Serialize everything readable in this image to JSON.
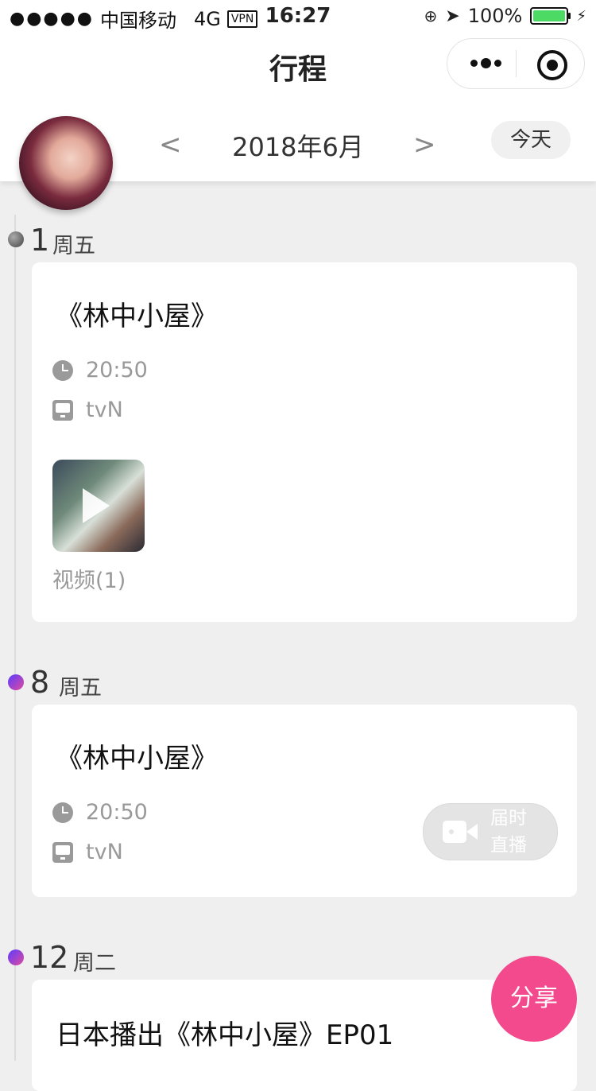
{
  "status_bar": {
    "signal_dots": "●●●●●",
    "carrier": "中国移动",
    "network": "4G",
    "vpn": "VPN",
    "time": "16:27",
    "battery": "100%"
  },
  "nav": {
    "title": "行程"
  },
  "month_bar": {
    "prev": "<",
    "month": "2018年6月",
    "next": ">",
    "today": "今天"
  },
  "days": [
    {
      "day": "1",
      "weekday": "周五",
      "event": {
        "title": "《林中小屋》",
        "time": "20:50",
        "channel": "tvN",
        "video_count": "视频(1)"
      }
    },
    {
      "day": "8",
      "weekday": "周五",
      "event": {
        "title": "《林中小屋》",
        "time": "20:50",
        "channel": "tvN",
        "live_label": "届时直播"
      }
    },
    {
      "day": "12",
      "weekday": "周二",
      "event": {
        "title": "日本播出《林中小屋》EP01"
      }
    }
  ],
  "share": "分享",
  "colors": {
    "accent_pink": "#f24a8c",
    "battery_green": "#4cd964"
  }
}
